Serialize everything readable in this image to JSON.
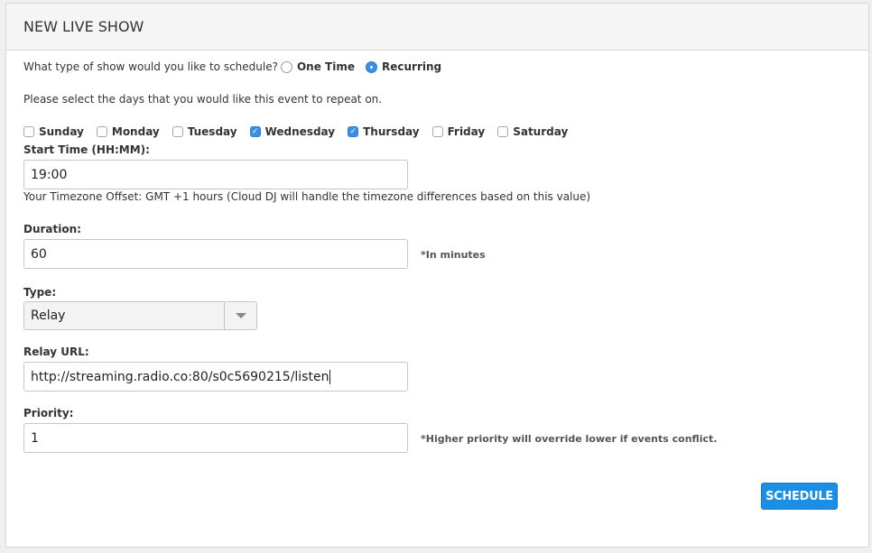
{
  "header": {
    "title": "NEW LIVE SHOW"
  },
  "show_type": {
    "question": "What type of show would you like to schedule?",
    "options": [
      {
        "label": "One Time",
        "selected": false
      },
      {
        "label": "Recurring",
        "selected": true
      }
    ]
  },
  "days": {
    "prompt": "Please select the days that you would like this event to repeat on.",
    "items": [
      {
        "label": "Sunday",
        "checked": false
      },
      {
        "label": "Monday",
        "checked": false
      },
      {
        "label": "Tuesday",
        "checked": false
      },
      {
        "label": "Wednesday",
        "checked": true
      },
      {
        "label": "Thursday",
        "checked": true
      },
      {
        "label": "Friday",
        "checked": false
      },
      {
        "label": "Saturday",
        "checked": false
      }
    ]
  },
  "start_time": {
    "label": "Start Time (HH:MM):",
    "value": "19:00",
    "note": "Your Timezone Offset: GMT +1 hours (Cloud DJ will handle the timezone differences based on this value)"
  },
  "duration": {
    "label": "Duration:",
    "value": "60",
    "hint": "*In minutes"
  },
  "type": {
    "label": "Type:",
    "value": "Relay"
  },
  "relay_url": {
    "label": "Relay URL:",
    "value": "http://streaming.radio.co:80/s0c5690215/listen"
  },
  "priority": {
    "label": "Priority:",
    "value": "1",
    "hint": "*Higher priority will override lower if events conflict."
  },
  "actions": {
    "schedule_label": "SCHEDULE"
  },
  "colors": {
    "accent": "#1a8fe3"
  }
}
